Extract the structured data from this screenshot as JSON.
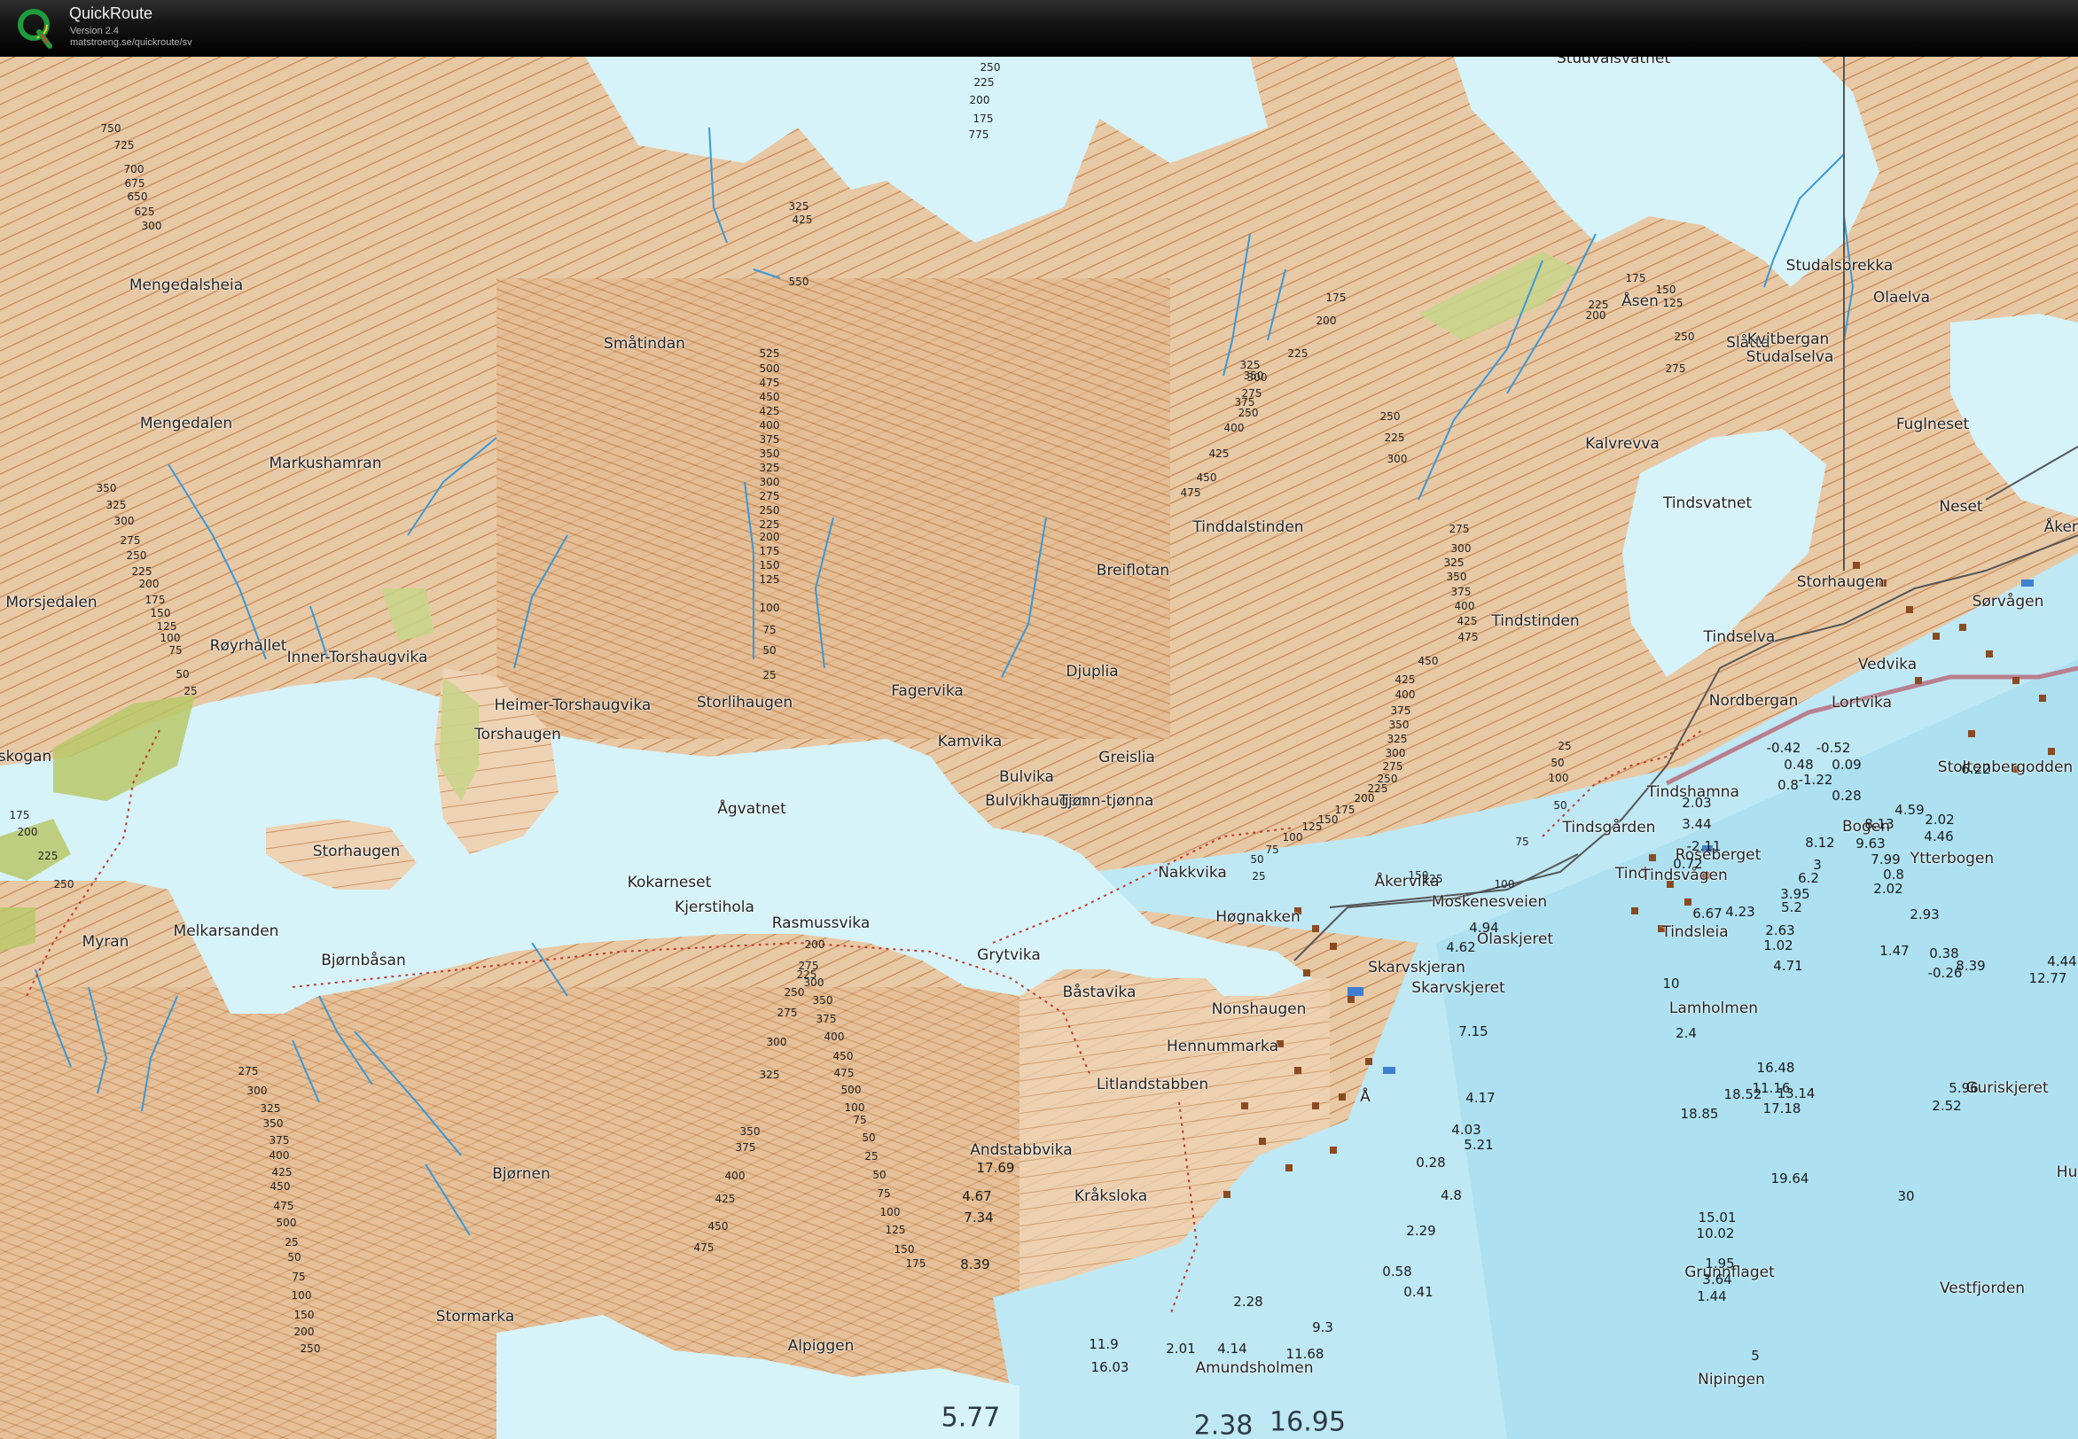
{
  "app": {
    "name": "QuickRoute",
    "version": "Version 2.4",
    "url": "matstroeng.se/quickroute/sv",
    "logo_icon": "quickroute-q-logo-icon"
  },
  "colors": {
    "water": "#d6f3fa",
    "sea": "#b8e6f4",
    "terrain": "#e8c9a6",
    "contour": "#c98a52",
    "stream": "#3a98d6",
    "path": "#c0392b",
    "road": "#777777",
    "marsh": "#c8d48a"
  },
  "place_names": [
    "Studvalsvatnet",
    "Mengedalsheia",
    "Småtindan",
    "Mengedalen",
    "Markushamran",
    "Morsjedalen",
    "Røyrhallet",
    "Inner-Torshaugvika",
    "Heimer-Torshaugvika",
    "Torshaugen",
    "Storlihaugen",
    "Fagervika",
    "Kamvika",
    "Djuplia",
    "Bulvika",
    "Bulvikhaugen",
    "Greislia",
    "Tjønn-tjønna",
    "Ågvatnet",
    "skogan",
    "Storhaugen",
    "Kokarneset",
    "Kjerstihola",
    "Rasmussvika",
    "Myran",
    "Melkarsanden",
    "Bjørnbåsan",
    "Grytvika",
    "Båstavika",
    "Nonshaugen",
    "Hennummarka",
    "Litlandstabben",
    "Andstabbvika",
    "Kråksloka",
    "Bjørnen",
    "Stormarka",
    "Alpiggen",
    "Amundsholmen",
    "Breiflotan",
    "Tinddalstinden",
    "Tindstinden",
    "Nakkvika",
    "Høgnakken",
    "Åkervika",
    "Moskenesveien",
    "Skarvskjeran",
    "Skarvskjeret",
    "Olaskjeret",
    "Å",
    "Åsen",
    "Kalvrevva",
    "Tindsvatnet",
    "Studalsbrekka",
    "Olaelva",
    "Slåtta",
    "Kvitbergan",
    "Studalselva",
    "Fuglneset",
    "Neset",
    "Åkern",
    "Storhaugen",
    "Sørvågen",
    "Tindselva",
    "Vedvika",
    "Lortvika",
    "Nordbergan",
    "Stoltenbergodden",
    "Tindshamna",
    "Tindsgården",
    "Bogen",
    "Roseberget",
    "Tind",
    "Tindsvågen",
    "Ytterbogen",
    "Tindsleia",
    "Lamholmen",
    "Guriskjeret",
    "Grunnflaget",
    "Nipingen",
    "Vestfjorden",
    "Hus"
  ],
  "depths": [
    "4.94",
    "4.62",
    "7.15",
    "4.17",
    "4.03",
    "5.21",
    "0.28",
    "4.8",
    "2.29",
    "0.58",
    "0.41",
    "2.28",
    "9.3",
    "11.68",
    "2.01",
    "4.14",
    "11.9",
    "16.03",
    "17.69",
    "4.67",
    "7.34",
    "8.39",
    "-0.42",
    "-0.52",
    "0.48",
    "0.09",
    "-1.22",
    "0.28",
    "0.8",
    "2.03",
    "3.44",
    "-2.11",
    "0.72",
    "8.12",
    "9.63",
    "8.13",
    "4.59",
    "2.02",
    "6.22",
    "7.99",
    "4.46",
    "3",
    "6.2",
    "0.8",
    "2.02",
    "3.95",
    "5.2",
    "6.67",
    "4.23",
    "2.63",
    "1.02",
    "4.71",
    "2.93",
    "1.47",
    "0.38",
    "-0.26",
    "8.39",
    "4.44",
    "12.77",
    "2.4",
    "16.48",
    "11.16",
    "18.52",
    "13.14",
    "17.18",
    "5.96",
    "2.52",
    "18.85",
    "19.64",
    "15.01",
    "10.02",
    "1.95",
    "3.64",
    "1.44",
    "30",
    "10",
    "5"
  ],
  "contour_labels": [
    "250",
    "225",
    "200",
    "175",
    "775",
    "750",
    "725",
    "700",
    "675",
    "650",
    "625",
    "300",
    "325",
    "425",
    "550",
    "525",
    "500",
    "475",
    "450",
    "425",
    "400",
    "375",
    "350",
    "325",
    "300",
    "275",
    "250",
    "225",
    "200",
    "175",
    "150",
    "125",
    "100",
    "75",
    "50",
    "25",
    "350",
    "325",
    "300",
    "275",
    "250",
    "225",
    "200",
    "175",
    "150",
    "125",
    "100",
    "75",
    "50",
    "25",
    "175",
    "200",
    "225",
    "250",
    "275",
    "300",
    "325",
    "350",
    "375",
    "400",
    "425",
    "450",
    "475",
    "150",
    "125",
    "175",
    "200",
    "225",
    "250",
    "275",
    "300",
    "225",
    "250",
    "275",
    "300",
    "325",
    "350",
    "375",
    "400",
    "425",
    "475",
    "450",
    "425",
    "400",
    "375",
    "350",
    "325",
    "300",
    "275",
    "250",
    "225",
    "200",
    "175",
    "150",
    "125",
    "100",
    "75",
    "50",
    "25",
    "100",
    "50",
    "25",
    "50",
    "75",
    "100",
    "125",
    "150",
    "175",
    "200",
    "225",
    "250",
    "275",
    "300",
    "325",
    "350",
    "375",
    "400",
    "425",
    "450",
    "475",
    "500",
    "25",
    "50",
    "75",
    "100",
    "150",
    "200",
    "250",
    "275",
    "300",
    "350",
    "375",
    "400",
    "450",
    "475",
    "500",
    "100",
    "75",
    "50",
    "25",
    "50",
    "75",
    "100",
    "125",
    "150",
    "175",
    "200",
    "225",
    "250",
    "275",
    "300",
    "325",
    "350",
    "375",
    "400",
    "425",
    "450",
    "475"
  ],
  "bottom_numbers": [
    "5.77",
    "2.38",
    "16.95"
  ]
}
